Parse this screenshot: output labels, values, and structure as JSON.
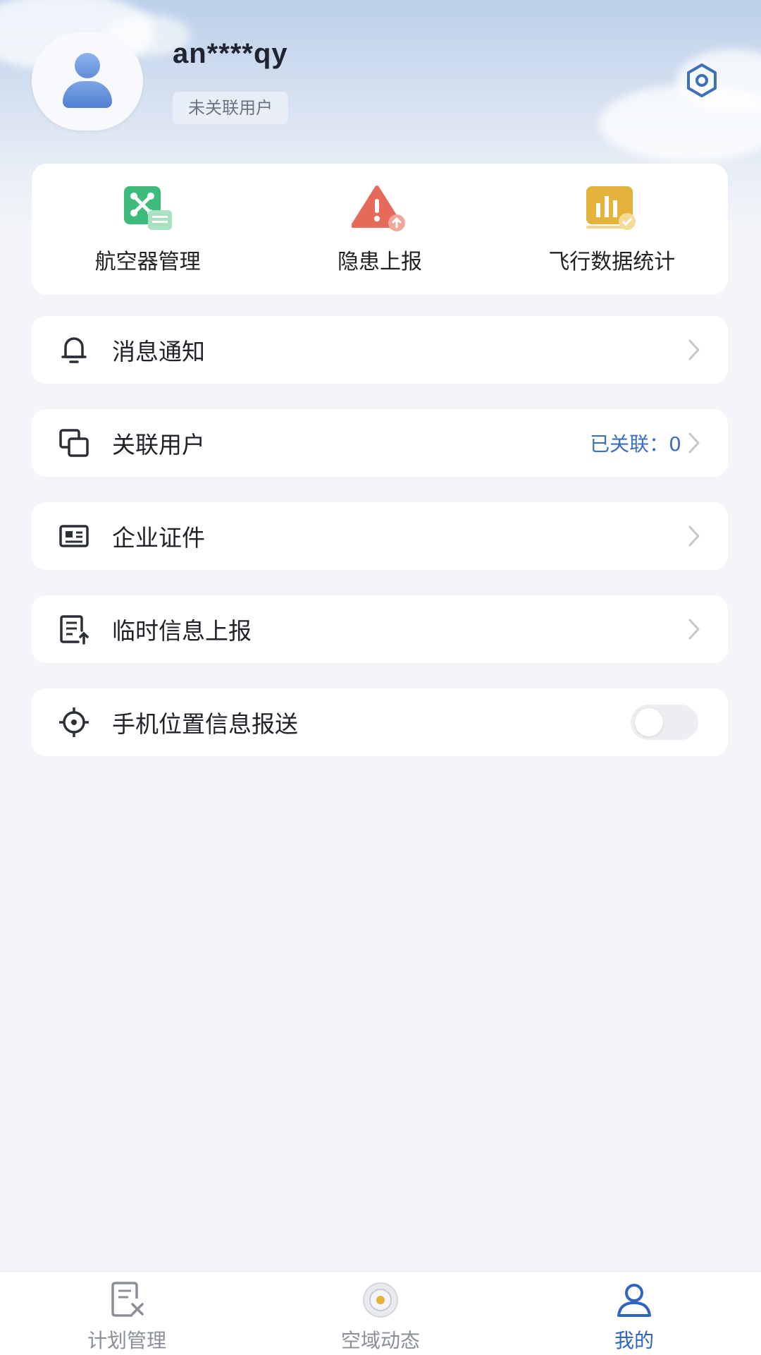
{
  "profile": {
    "username": "an****qy",
    "badge": "未关联用户"
  },
  "quick_actions": [
    {
      "label": "航空器管理",
      "icon": "aircraft-management-icon",
      "color": "#3dbb7c"
    },
    {
      "label": "隐患上报",
      "icon": "hazard-report-icon",
      "color": "#e56a5a"
    },
    {
      "label": "飞行数据统计",
      "icon": "flight-stats-icon",
      "color": "#e2b23a"
    }
  ],
  "menu": {
    "messages": {
      "label": "消息通知",
      "icon": "bell-icon"
    },
    "linked_users": {
      "label": "关联用户",
      "value": "已关联：0",
      "icon": "linked-users-icon"
    },
    "certificates": {
      "label": "企业证件",
      "icon": "certificate-icon"
    },
    "temp_report": {
      "label": "临时信息上报",
      "icon": "document-upload-icon"
    },
    "location": {
      "label": "手机位置信息报送",
      "icon": "crosshair-icon",
      "enabled": false
    }
  },
  "bottom_nav": [
    {
      "label": "计划管理",
      "icon": "plan-management-icon",
      "active": false
    },
    {
      "label": "空域动态",
      "icon": "airspace-icon",
      "active": false
    },
    {
      "label": "我的",
      "icon": "profile-icon",
      "active": true
    }
  ],
  "colors": {
    "accent": "#2f64c0",
    "link_value": "#3d6fbd"
  }
}
